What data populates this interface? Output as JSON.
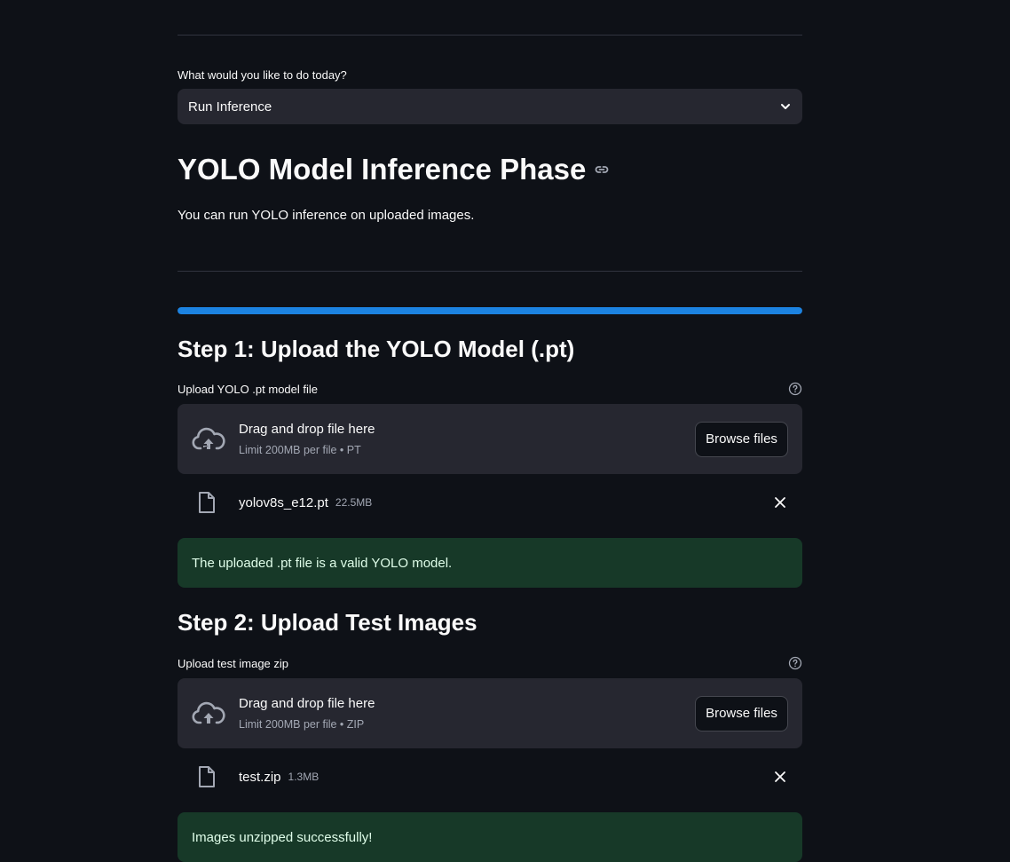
{
  "select": {
    "label": "What would you like to do today?",
    "value": "Run Inference"
  },
  "header": {
    "title": "YOLO Model Inference Phase",
    "subtitle": "You can run YOLO inference on uploaded images."
  },
  "progress": {
    "fraction": 1.0,
    "color": "#1c83e1"
  },
  "step1": {
    "title": "Step 1: Upload the YOLO Model (.pt)",
    "upload_label": "Upload YOLO .pt model file",
    "dropzone_main": "Drag and drop file here",
    "dropzone_sub": "Limit 200MB per file • PT",
    "browse_label": "Browse files",
    "file_name": "yolov8s_e12.pt",
    "file_size": "22.5MB",
    "alert": "The uploaded .pt file is a valid YOLO model."
  },
  "step2": {
    "title": "Step 2: Upload Test Images",
    "upload_label": "Upload test image zip",
    "dropzone_main": "Drag and drop file here",
    "dropzone_sub": "Limit 200MB per file • ZIP",
    "browse_label": "Browse files",
    "file_name": "test.zip",
    "file_size": "1.3MB",
    "alert": "Images unzipped successfully!"
  },
  "icons": {
    "select_chevron": "chevron-down-icon",
    "title_anchor": "link-icon",
    "help": "question-circle-icon",
    "upload": "cloud-upload-icon",
    "file": "file-icon",
    "remove": "close-icon"
  },
  "colors": {
    "background": "#0e1117",
    "surface": "#262730",
    "success_bg": "#173928",
    "success_text": "#dffde9",
    "accent": "#1c83e1"
  }
}
